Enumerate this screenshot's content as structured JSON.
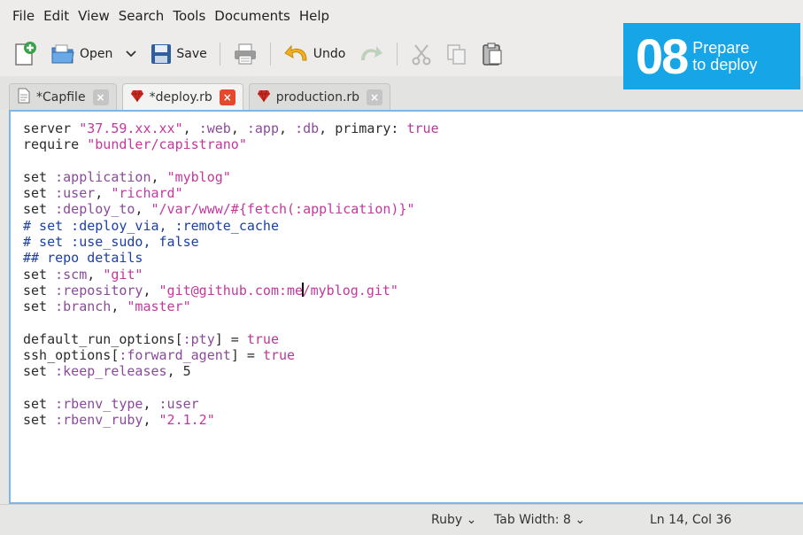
{
  "menu": [
    "File",
    "Edit",
    "View",
    "Search",
    "Tools",
    "Documents",
    "Help"
  ],
  "toolbar": {
    "open_label": "Open",
    "save_label": "Save",
    "undo_label": "Undo"
  },
  "tabs": [
    {
      "label": "*Capfile",
      "active": false
    },
    {
      "label": "*deploy.rb",
      "active": true
    },
    {
      "label": "production.rb",
      "active": false
    }
  ],
  "badge": {
    "number": "08",
    "line1": "Prepare",
    "line2": "to deploy",
    "color": "#16a6e8"
  },
  "editor": {
    "caret_after": "set :repository, \"git@github.com:me",
    "lines": [
      [
        [
          "t",
          "server "
        ],
        [
          "s",
          "\"37.59.xx.xx\""
        ],
        [
          "t",
          ", "
        ],
        [
          "y",
          ":web"
        ],
        [
          "t",
          ", "
        ],
        [
          "y",
          ":app"
        ],
        [
          "t",
          ", "
        ],
        [
          "y",
          ":db"
        ],
        [
          "t",
          ", primary: "
        ],
        [
          "k",
          "true"
        ]
      ],
      [
        [
          "t",
          "require "
        ],
        [
          "s",
          "\"bundler/capistrano\""
        ]
      ],
      [],
      [
        [
          "t",
          "set "
        ],
        [
          "y",
          ":application"
        ],
        [
          "t",
          ", "
        ],
        [
          "s",
          "\"myblog\""
        ]
      ],
      [
        [
          "t",
          "set "
        ],
        [
          "y",
          ":user"
        ],
        [
          "t",
          ", "
        ],
        [
          "s",
          "\"richard\""
        ]
      ],
      [
        [
          "t",
          "set "
        ],
        [
          "y",
          ":deploy_to"
        ],
        [
          "t",
          ", "
        ],
        [
          "s",
          "\"/var/www/#{fetch(:application)}\""
        ]
      ],
      [
        [
          "c",
          "# set :deploy_via, :remote_cache"
        ]
      ],
      [
        [
          "c",
          "# set :use_sudo, false"
        ]
      ],
      [
        [
          "c",
          "## repo details"
        ]
      ],
      [
        [
          "t",
          "set "
        ],
        [
          "y",
          ":scm"
        ],
        [
          "t",
          ", "
        ],
        [
          "s",
          "\"git\""
        ]
      ],
      [
        [
          "t",
          "set "
        ],
        [
          "y",
          ":repository"
        ],
        [
          "t",
          ", "
        ],
        [
          "s",
          "\"git@github.com:me"
        ],
        [
          "caret",
          ""
        ],
        [
          "s",
          "/myblog.git\""
        ]
      ],
      [
        [
          "t",
          "set "
        ],
        [
          "y",
          ":branch"
        ],
        [
          "t",
          ", "
        ],
        [
          "s",
          "\"master\""
        ]
      ],
      [],
      [
        [
          "t",
          "default_run_options["
        ],
        [
          "y",
          ":pty"
        ],
        [
          "t",
          "] = "
        ],
        [
          "k",
          "true"
        ]
      ],
      [
        [
          "t",
          "ssh_options["
        ],
        [
          "y",
          ":forward_agent"
        ],
        [
          "t",
          "] = "
        ],
        [
          "k",
          "true"
        ]
      ],
      [
        [
          "t",
          "set "
        ],
        [
          "y",
          ":keep_releases"
        ],
        [
          "t",
          ", 5"
        ]
      ],
      [],
      [
        [
          "t",
          "set "
        ],
        [
          "y",
          ":rbenv_type"
        ],
        [
          "t",
          ", "
        ],
        [
          "y",
          ":user"
        ]
      ],
      [
        [
          "t",
          "set "
        ],
        [
          "y",
          ":rbenv_ruby"
        ],
        [
          "t",
          ", "
        ],
        [
          "s",
          "\"2.1.2\""
        ]
      ]
    ]
  },
  "syntax_colors": {
    "t": "#2b2b2b",
    "s": "#c2389c",
    "y": "#8a4a9a",
    "k": "#b7399a",
    "c": "#1a3fa6"
  },
  "status": {
    "language": "Ruby",
    "tab_width": "Tab Width: 8",
    "position": "Ln 14, Col 36"
  }
}
